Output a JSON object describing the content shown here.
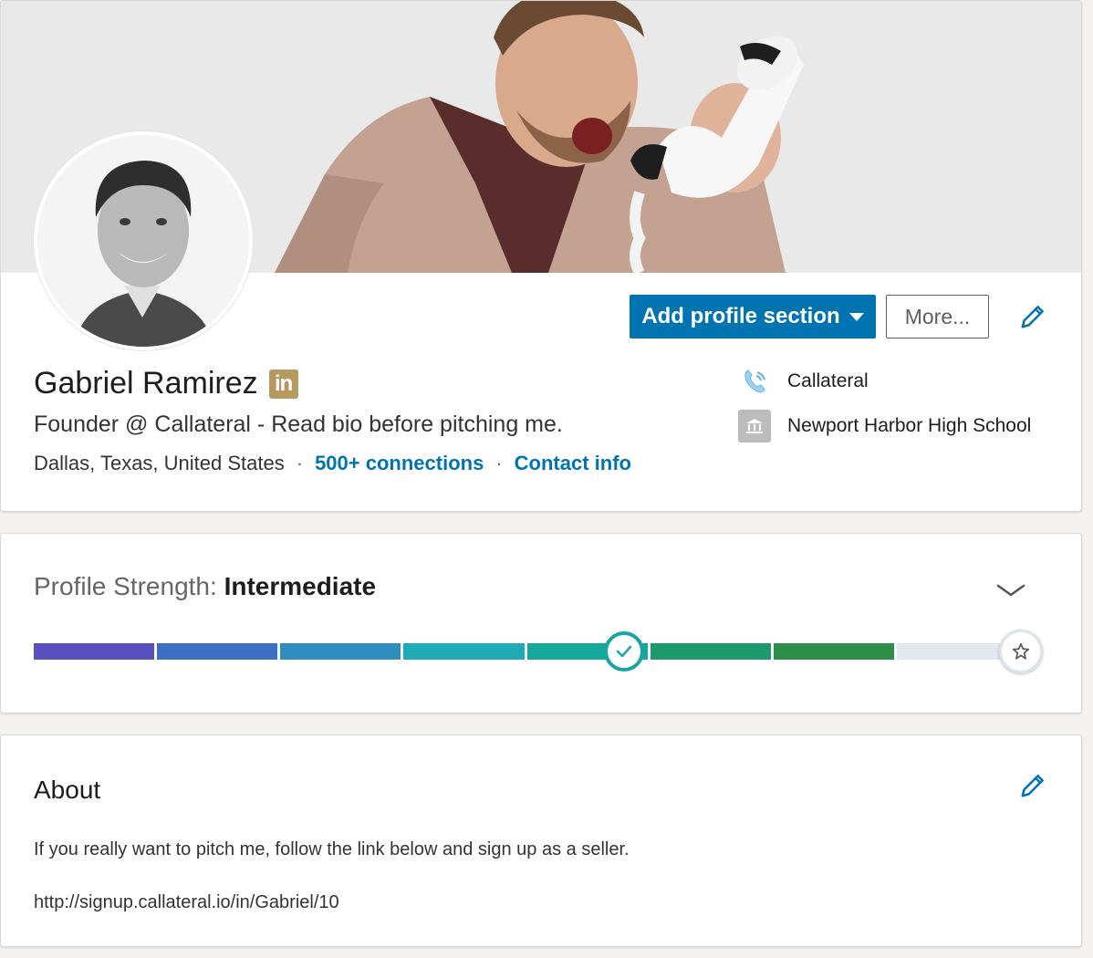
{
  "profile": {
    "name": "Gabriel Ramirez",
    "badge": "in",
    "headline": "Founder @ Callateral - Read bio before pitching me.",
    "location": "Dallas, Texas, United States",
    "connections": "500+ connections",
    "contact_info": "Contact info",
    "separator": "·",
    "current_company": "Callateral",
    "school": "Newport Harbor High School"
  },
  "actions": {
    "add_section": "Add profile section",
    "more": "More..."
  },
  "strength": {
    "label": "Profile Strength: ",
    "level": "Intermediate",
    "progress_fraction": 0.6,
    "segment_colors": [
      "#5a4fbf",
      "#3b70c2",
      "#2f8dbf",
      "#1faab8",
      "#16a89a",
      "#1c9a6e",
      "#2a8f48",
      "#e3e8ee"
    ],
    "marker_color": "#1aa5a5"
  },
  "about": {
    "title": "About",
    "text": "If you really want to pitch me, follow the link below and sign up as a seller.",
    "link": "http://signup.callateral.io/in/Gabriel/10"
  },
  "colors": {
    "accent": "#0073b1",
    "badge": "#b5995f"
  },
  "icons": {
    "company": "phone-icon",
    "school": "school-icon",
    "edit": "pencil-icon",
    "expand": "chevron-down-icon",
    "goal": "star-icon",
    "progress": "check-icon"
  }
}
